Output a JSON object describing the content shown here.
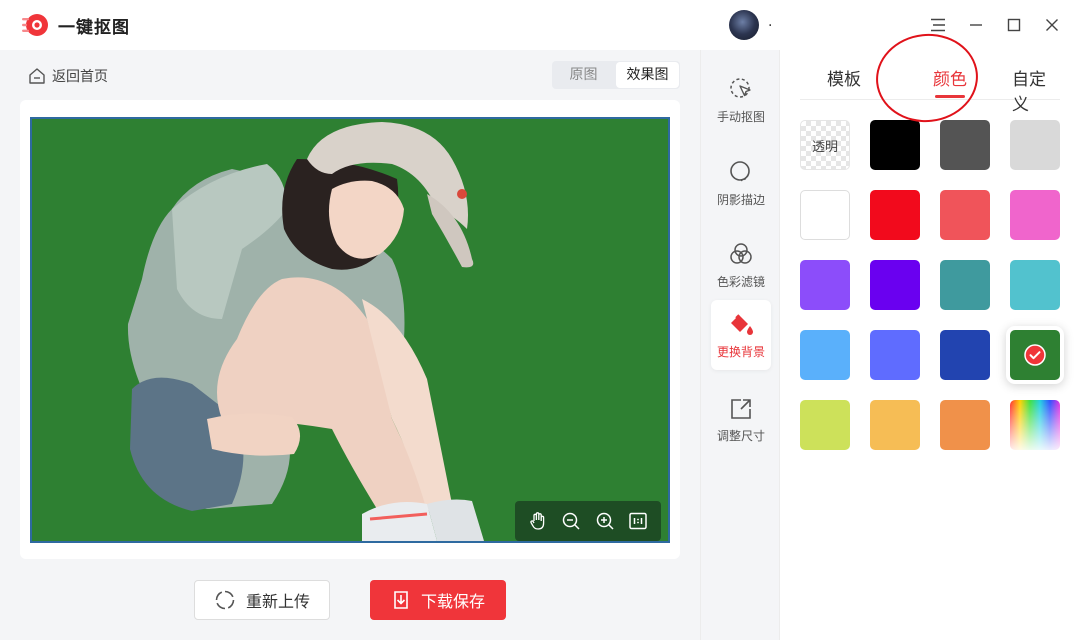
{
  "app": {
    "title": "一键抠图"
  },
  "user": {
    "name": "."
  },
  "workarea": {
    "back_label": "返回首页",
    "view_toggle": {
      "original": "原图",
      "result": "效果图",
      "selected": "效果图"
    },
    "canvas_background": "#2e8032",
    "zoom_tools": [
      "hand-icon",
      "zoom-out-icon",
      "zoom-in-icon",
      "actual-size-icon"
    ]
  },
  "actions": {
    "reupload_label": "重新上传",
    "download_label": "下载保存"
  },
  "tools": [
    {
      "label": "手动抠图",
      "icon": "manual-cutout-icon"
    },
    {
      "label": "阴影描边",
      "icon": "shadow-stroke-icon"
    },
    {
      "label": "色彩滤镜",
      "icon": "color-filter-icon"
    },
    {
      "label": "更换背景",
      "icon": "paint-bucket-icon",
      "active": true
    },
    {
      "label": "调整尺寸",
      "icon": "resize-icon"
    }
  ],
  "panel": {
    "tabs": [
      {
        "label": "模板"
      },
      {
        "label": "颜色",
        "active": true
      },
      {
        "label": "自定义"
      }
    ],
    "transparent_label": "透明",
    "swatches": [
      "transparent",
      "#000000",
      "#545454",
      "#d9d9d9",
      "#ffffff",
      "#f20a1c",
      "#f0545a",
      "#f065cc",
      "#8c4dfa",
      "#6a00f0",
      "#3f9a9e",
      "#52c2ce",
      "#5ab0fb",
      "#5f6cff",
      "#2244b0",
      "#2e8032",
      "#cde15a",
      "#f6bd55",
      "#f0914a",
      "rainbow"
    ],
    "selected_swatch": "#2e8032"
  },
  "colors": {
    "accent": "#e8353a",
    "download_button": "#f0353a"
  }
}
